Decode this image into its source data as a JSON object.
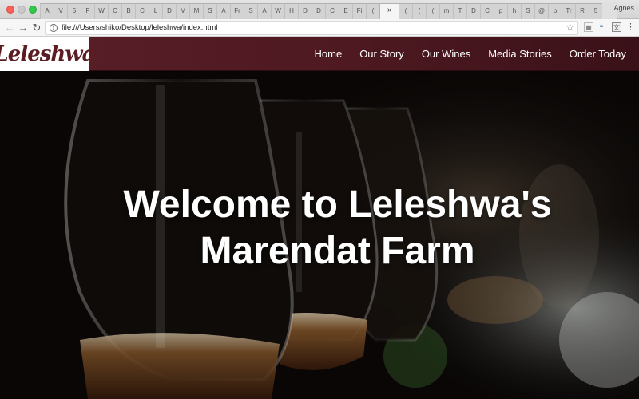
{
  "browser": {
    "tabs": [
      "A",
      "V",
      "5",
      "F",
      "W",
      "C",
      "B",
      "C",
      "L",
      "D",
      "V",
      "M",
      "S",
      "A",
      "Fr",
      "S",
      "A",
      "W",
      "H",
      "D",
      "D",
      "C",
      "E",
      "Fi",
      "(",
      "(",
      "(",
      "(",
      "m",
      "T",
      "D",
      "C",
      "p",
      "h",
      "S",
      "@",
      "b",
      "Tr",
      "R",
      "5"
    ],
    "active_tab_index": 24,
    "active_tab_close": "×",
    "profile_name": "Agnes",
    "url": "file:///Users/shiko/Desktop/leleshwa/index.html"
  },
  "site": {
    "logo": "Leleshwa",
    "nav": [
      "Home",
      "Our Story",
      "Our Wines",
      "Media Stories",
      "Order Today"
    ],
    "hero_title_line1": "Welcome to Leleshwa's",
    "hero_title_line2": "Marendat Farm"
  },
  "colors": {
    "header_bg": "#541c24",
    "logo_color": "#5b1d22",
    "hero_text": "#ffffff"
  },
  "icons": {
    "back": "back-arrow-icon",
    "forward": "forward-arrow-icon",
    "reload": "reload-icon",
    "info": "info-icon",
    "bookmark": "star-icon",
    "menu": "kebab-menu-icon"
  }
}
